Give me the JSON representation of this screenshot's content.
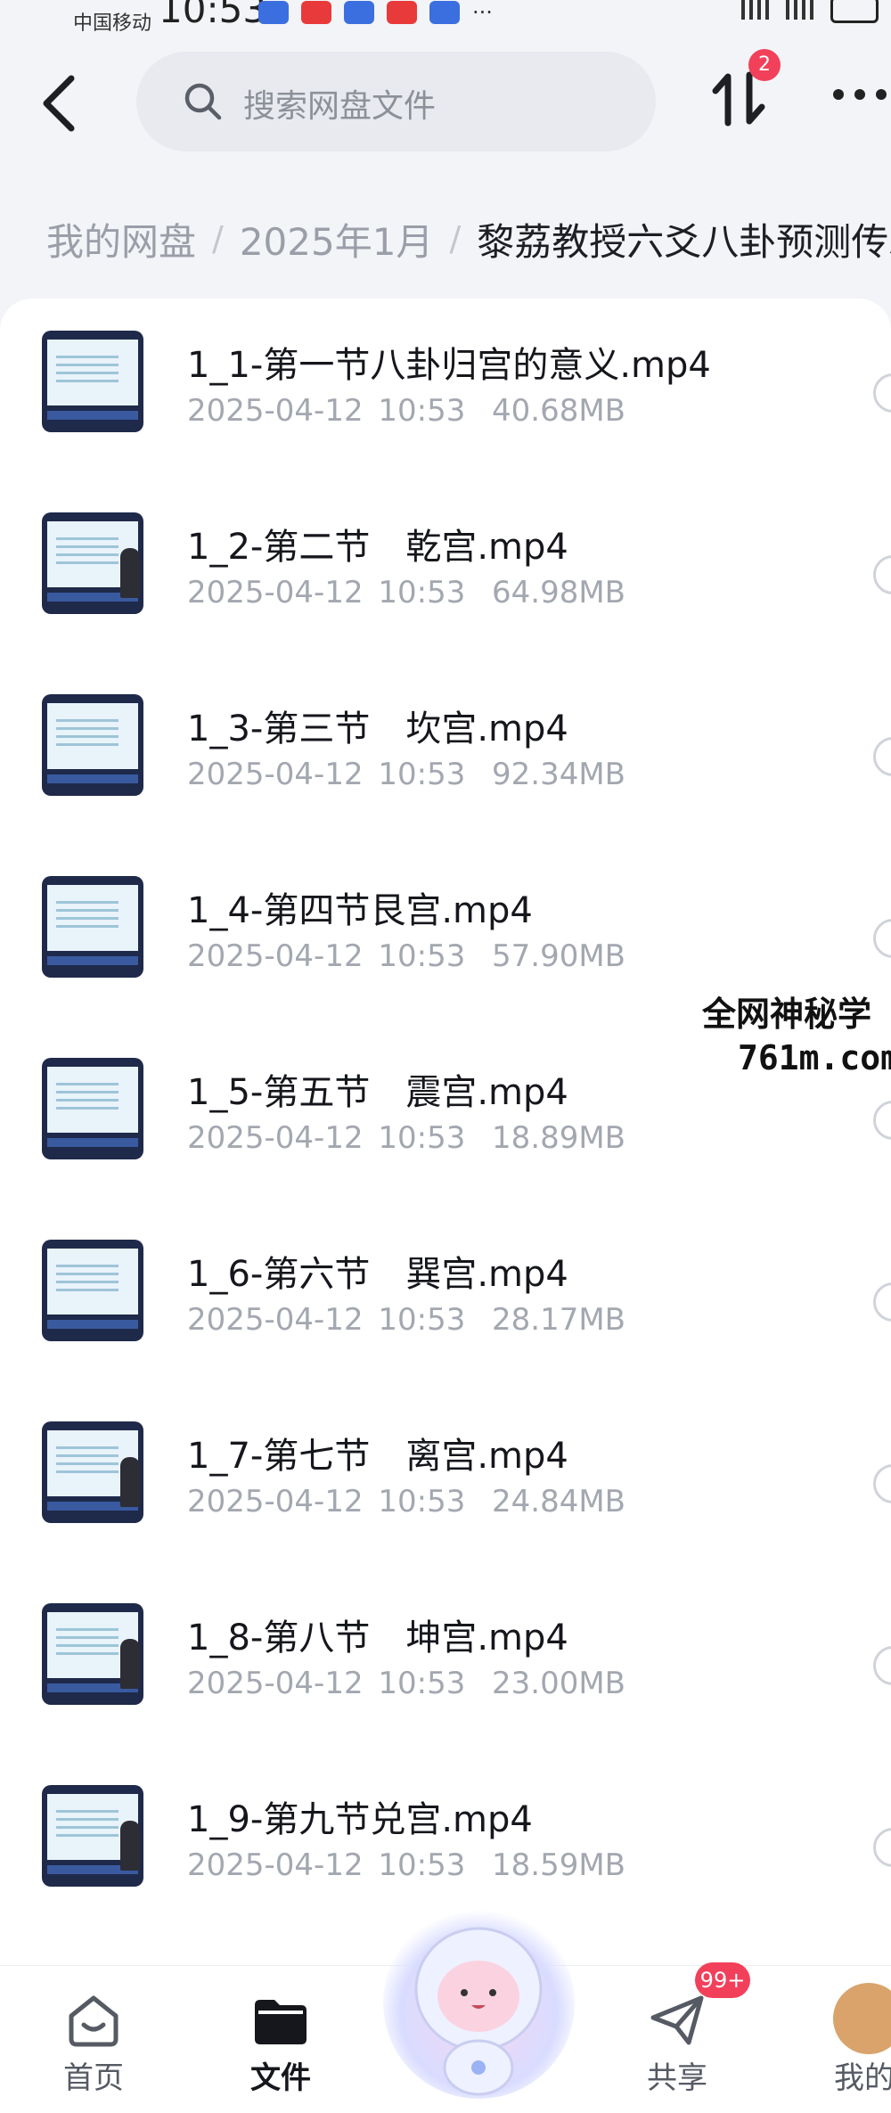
{
  "status_bar": {
    "carrier": "中国移动",
    "time": "10:53"
  },
  "header": {
    "search_placeholder": "搜索网盘文件",
    "transfer_badge": "2"
  },
  "breadcrumb": [
    "我的网盘",
    "2025年1月",
    "黎荔教授六爻八卦预测传承"
  ],
  "files": [
    {
      "name": "1_1-第一节八卦归宫的意义.mp4",
      "date": "2025-04-12  10:53",
      "size": "40.68MB"
    },
    {
      "name": "1_2-第二节　乾宫.mp4",
      "date": "2025-04-12  10:53",
      "size": "64.98MB"
    },
    {
      "name": "1_3-第三节　坎宫.mp4",
      "date": "2025-04-12  10:53",
      "size": "92.34MB"
    },
    {
      "name": "1_4-第四节艮宫.mp4",
      "date": "2025-04-12  10:53",
      "size": "57.90MB"
    },
    {
      "name": "1_5-第五节　震宫.mp4",
      "date": "2025-04-12  10:53",
      "size": "18.89MB"
    },
    {
      "name": "1_6-第六节　巽宫.mp4",
      "date": "2025-04-12  10:53",
      "size": "28.17MB"
    },
    {
      "name": "1_7-第七节　离宫.mp4",
      "date": "2025-04-12  10:53",
      "size": "24.84MB"
    },
    {
      "name": "1_8-第八节　坤宫.mp4",
      "date": "2025-04-12  10:53",
      "size": "23.00MB"
    },
    {
      "name": "1_9-第九节兑宫.mp4",
      "date": "2025-04-12  10:53",
      "size": "18.59MB"
    }
  ],
  "watermark": {
    "line1": "全网神秘学",
    "line2": "761m.com"
  },
  "bottom_nav": {
    "home": "首页",
    "files": "文件",
    "share": "共享",
    "share_badge": "99+",
    "me": "我的"
  }
}
